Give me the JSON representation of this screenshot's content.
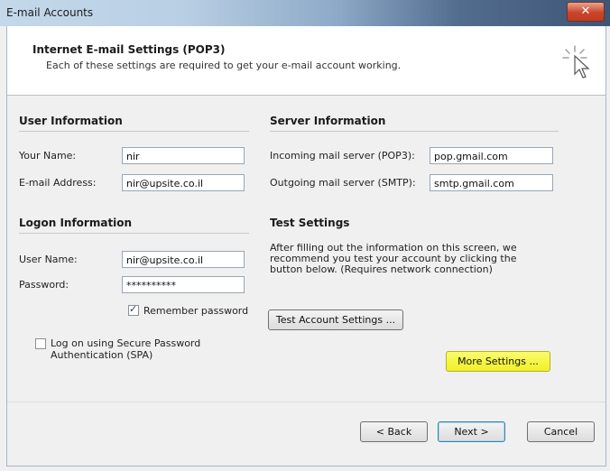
{
  "window": {
    "title": "E-mail Accounts",
    "close_label": "✕"
  },
  "header": {
    "title": "Internet E-mail Settings (POP3)",
    "subtitle": "Each of these settings are required to get your e-mail account working."
  },
  "user_info": {
    "section_title": "User Information",
    "name_label": "Your Name:",
    "name_value": "nir",
    "email_label": "E-mail Address:",
    "email_value": "nir@upsite.co.il"
  },
  "server_info": {
    "section_title": "Server Information",
    "incoming_label": "Incoming mail server (POP3):",
    "incoming_value": "pop.gmail.com",
    "outgoing_label": "Outgoing mail server (SMTP):",
    "outgoing_value": "smtp.gmail.com"
  },
  "logon_info": {
    "section_title": "Logon Information",
    "username_label": "User Name:",
    "username_value": "nir@upsite.co.il",
    "password_label": "Password:",
    "password_value": "**********",
    "remember_label": "Remember password",
    "remember_checked": true,
    "spa_label_line1": "Log on using Secure Password",
    "spa_label_line2": "Authentication (SPA)",
    "spa_checked": false
  },
  "test_settings": {
    "section_title": "Test Settings",
    "description_line1": "After filling out the information on this screen, we",
    "description_line2": "recommend you test your account by clicking the",
    "description_line3": "button below. (Requires network connection)",
    "test_button_label": "Test Account Settings ...",
    "more_settings_label": "More Settings ..."
  },
  "footer": {
    "back_label": "< Back",
    "next_label": "Next >",
    "cancel_label": "Cancel"
  },
  "colors": {
    "highlight": "#f3f22e",
    "title_gradient_end": "#3e5575"
  },
  "icons": {
    "header_icon": "cursor-click-icon",
    "close": "close-icon"
  }
}
